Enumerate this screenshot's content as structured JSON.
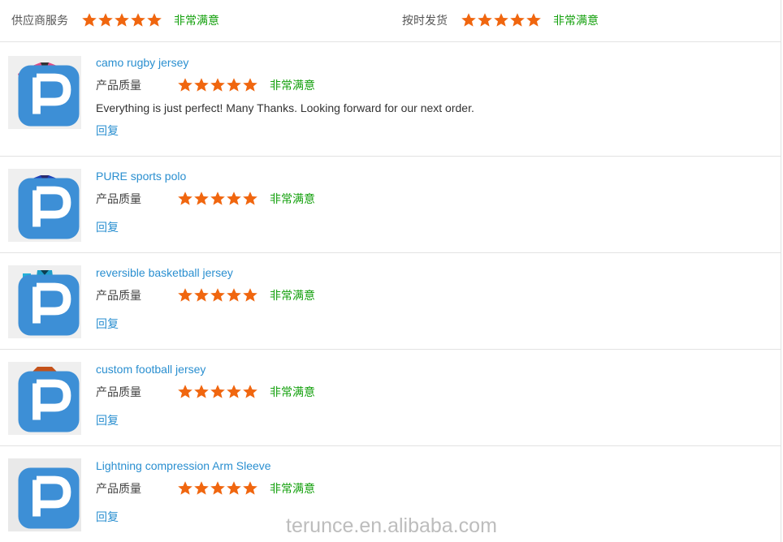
{
  "summary": {
    "supplier_service": {
      "label": "供应商服务",
      "rating": 5,
      "rating_text": "非常满意"
    },
    "on_time_shipping": {
      "label": "按时发货",
      "rating": 5,
      "rating_text": "非常满意"
    }
  },
  "reviews": [
    {
      "product": "camo rugby jersey",
      "quality_label": "产品质量",
      "rating": 5,
      "rating_text": "非常满意",
      "comment": "Everything is just perfect! Many Thanks. Looking forward for our next order.",
      "reply": "回复"
    },
    {
      "product": "PURE sports polo",
      "quality_label": "产品质量",
      "rating": 5,
      "rating_text": "非常满意",
      "comment": "",
      "reply": "回复"
    },
    {
      "product": "reversible basketball jersey",
      "quality_label": "产品质量",
      "rating": 5,
      "rating_text": "非常满意",
      "comment": "",
      "reply": "回复"
    },
    {
      "product": "custom football jersey",
      "quality_label": "产品质量",
      "rating": 5,
      "rating_text": "非常满意",
      "comment": "",
      "reply": "回复"
    },
    {
      "product": "Lightning compression Arm Sleeve",
      "quality_label": "产品质量",
      "rating": 5,
      "rating_text": "非常满意",
      "comment": "",
      "reply": "回复"
    }
  ],
  "watermark": "terunce.en.alibaba.com",
  "colors": {
    "star": "#f0660f",
    "rating_text": "#13a00c",
    "link": "#2a8fd0",
    "divider": "#e2e2e2"
  },
  "icons": {
    "star": "star-icon",
    "brand": "brand-logo-icon"
  }
}
